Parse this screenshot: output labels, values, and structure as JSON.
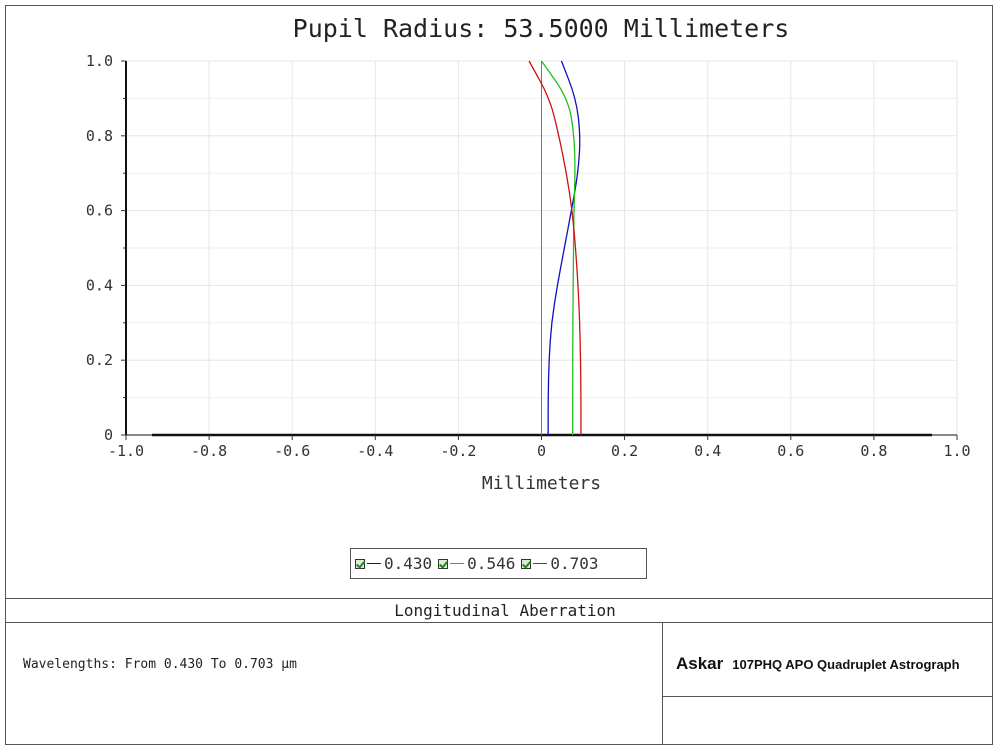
{
  "title": "Pupil Radius: 53.5000 Millimeters",
  "chart_data": {
    "type": "line",
    "title": "Pupil Radius: 53.5000 Millimeters",
    "xlabel": "Millimeters",
    "ylabel": "",
    "xlim": [
      -1.0,
      1.0
    ],
    "ylim": [
      0,
      1.0
    ],
    "grid": true,
    "x_ticks": [
      "-1.0",
      "-0.8",
      "-0.6",
      "-0.4",
      "-0.2",
      "0",
      "0.2",
      "0.4",
      "0.6",
      "0.8",
      "1.0"
    ],
    "y_ticks": [
      "0",
      "0.2",
      "0.4",
      "0.6",
      "0.8",
      "1.0"
    ],
    "legend_position": "bottom-center",
    "series": [
      {
        "name": "0.430",
        "color": "#1010c0",
        "points": [
          [
            0.016,
            0.0
          ],
          [
            0.016,
            0.1
          ],
          [
            0.018,
            0.2
          ],
          [
            0.024,
            0.3
          ],
          [
            0.038,
            0.4
          ],
          [
            0.055,
            0.5
          ],
          [
            0.072,
            0.6
          ],
          [
            0.088,
            0.7
          ],
          [
            0.094,
            0.8
          ],
          [
            0.083,
            0.9
          ],
          [
            0.048,
            1.0
          ]
        ]
      },
      {
        "name": "0.546",
        "color": "#20c020",
        "points": [
          [
            0.075,
            0.0
          ],
          [
            0.075,
            0.2
          ],
          [
            0.076,
            0.4
          ],
          [
            0.078,
            0.6
          ],
          [
            0.081,
            0.7
          ],
          [
            0.079,
            0.8
          ],
          [
            0.064,
            0.9
          ],
          [
            0.0,
            1.0
          ]
        ]
      },
      {
        "name": "0.703",
        "color": "#d01010",
        "points": [
          [
            0.095,
            0.0
          ],
          [
            0.095,
            0.1
          ],
          [
            0.094,
            0.2
          ],
          [
            0.092,
            0.3
          ],
          [
            0.088,
            0.4
          ],
          [
            0.082,
            0.5
          ],
          [
            0.074,
            0.6
          ],
          [
            0.06,
            0.7
          ],
          [
            0.042,
            0.8
          ],
          [
            0.02,
            0.9
          ],
          [
            -0.03,
            1.0
          ]
        ]
      }
    ]
  },
  "legend": {
    "items": [
      {
        "label": "0.430",
        "color": "#1010c0"
      },
      {
        "label": "0.546",
        "color": "#20c020"
      },
      {
        "label": "0.703",
        "color": "#d01010"
      }
    ]
  },
  "footer": {
    "plot_name": "Longitudinal Aberration",
    "wavelengths": "Wavelengths: From 0.430 To 0.703 µm",
    "brand_logo": "Askar",
    "brand_model": "107PHQ APO Quadruplet Astrograph"
  }
}
